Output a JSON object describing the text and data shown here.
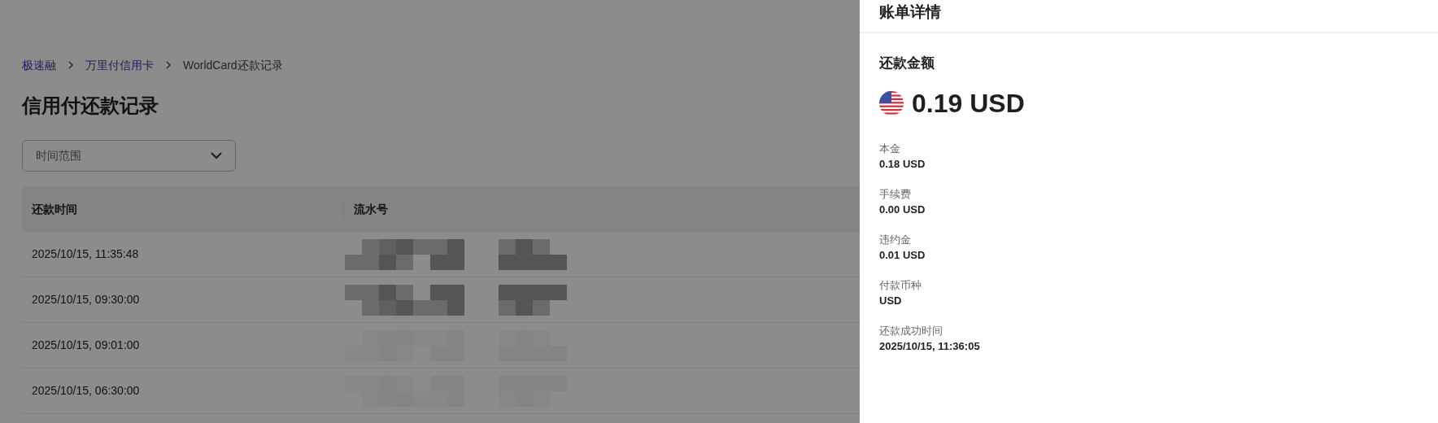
{
  "breadcrumb": [
    {
      "label": "极速融",
      "kind": "link"
    },
    {
      "label": "万里付信用卡",
      "kind": "link"
    },
    {
      "label": "WorldCard还款记录",
      "kind": "current"
    }
  ],
  "page_title": "信用付还款记录",
  "filter": {
    "placeholder": "时间范围"
  },
  "table": {
    "columns": [
      "还款时间",
      "流水号"
    ],
    "rows": [
      {
        "time": "2025/10/15, 11:35:48",
        "kind": "mosaic"
      },
      {
        "time": "2025/10/15, 09:30:00",
        "kind": "mosaic"
      },
      {
        "time": "2025/10/15, 09:01:00",
        "kind": "faint"
      },
      {
        "time": "2025/10/15, 06:30:00",
        "kind": "faint"
      }
    ]
  },
  "drawer": {
    "title": "账单详情",
    "amount_label": "还款金额",
    "amount": "0.19 USD",
    "fields": [
      {
        "label": "本金",
        "value": "0.18 USD"
      },
      {
        "label": "手续费",
        "value": "0.00 USD"
      },
      {
        "label": "违约金",
        "value": "0.01 USD"
      },
      {
        "label": "付款币种",
        "value": "USD"
      },
      {
        "label": "还款成功时间",
        "value": "2025/10/15, 11:36:05"
      }
    ]
  }
}
